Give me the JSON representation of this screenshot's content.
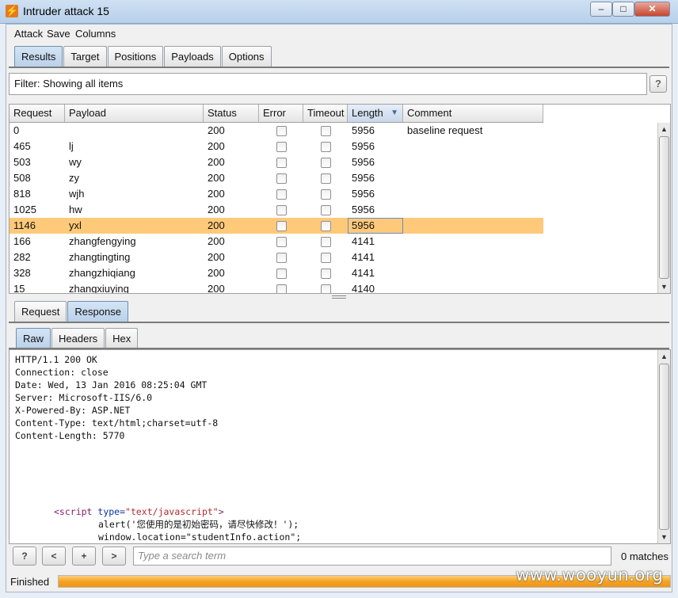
{
  "window": {
    "title": "Intruder attack 15",
    "minimize": "–",
    "maximize": "□",
    "close": "✕",
    "app_icon": "⚡"
  },
  "menu": [
    "Attack",
    "Save",
    "Columns"
  ],
  "main_tabs": [
    "Results",
    "Target",
    "Positions",
    "Payloads",
    "Options"
  ],
  "active_main_tab": "Results",
  "filter": {
    "text": "Filter: Showing all items",
    "help": "?"
  },
  "table": {
    "columns": [
      "Request",
      "Payload",
      "Status",
      "Error",
      "Timeout",
      "Length",
      "Comment"
    ],
    "sorted_column": "Length",
    "sort_icon": "▼",
    "rows": [
      {
        "request": "0",
        "payload": "",
        "status": "200",
        "error": false,
        "timeout": false,
        "length": "5956",
        "comment": "baseline request"
      },
      {
        "request": "465",
        "payload": "lj",
        "status": "200",
        "error": false,
        "timeout": false,
        "length": "5956",
        "comment": ""
      },
      {
        "request": "503",
        "payload": "wy",
        "status": "200",
        "error": false,
        "timeout": false,
        "length": "5956",
        "comment": ""
      },
      {
        "request": "508",
        "payload": "zy",
        "status": "200",
        "error": false,
        "timeout": false,
        "length": "5956",
        "comment": ""
      },
      {
        "request": "818",
        "payload": "wjh",
        "status": "200",
        "error": false,
        "timeout": false,
        "length": "5956",
        "comment": ""
      },
      {
        "request": "1025",
        "payload": "hw",
        "status": "200",
        "error": false,
        "timeout": false,
        "length": "5956",
        "comment": ""
      },
      {
        "request": "1146",
        "payload": "yxl",
        "status": "200",
        "error": false,
        "timeout": false,
        "length": "5956",
        "comment": "",
        "selected": true
      },
      {
        "request": "166",
        "payload": "zhangfengying",
        "status": "200",
        "error": false,
        "timeout": false,
        "length": "4141",
        "comment": ""
      },
      {
        "request": "282",
        "payload": "zhangtingting",
        "status": "200",
        "error": false,
        "timeout": false,
        "length": "4141",
        "comment": ""
      },
      {
        "request": "328",
        "payload": "zhangzhiqiang",
        "status": "200",
        "error": false,
        "timeout": false,
        "length": "4141",
        "comment": ""
      },
      {
        "request": "15",
        "payload": "zhangxiuying",
        "status": "200",
        "error": false,
        "timeout": false,
        "length": "4140",
        "comment": ""
      }
    ]
  },
  "detail_tabs": [
    "Request",
    "Response"
  ],
  "active_detail_tab": "Response",
  "view_tabs": [
    "Raw",
    "Headers",
    "Hex"
  ],
  "active_view_tab": "Raw",
  "response": {
    "headers": [
      "HTTP/1.1 200 OK",
      "Connection: close",
      "Date: Wed, 13 Jan 2016 08:25:04 GMT",
      "Server: Microsoft-IIS/6.0",
      "X-Powered-By: ASP.NET",
      "Content-Type: text/html;charset=utf-8",
      "Content-Length: 5770"
    ],
    "script_open_tag": "<script",
    "script_attr": "type=",
    "script_attr_value": "\"text/javascript\"",
    "script_close_bracket": ">",
    "script_line1": "alert('您使用的是初始密码，请尽快修改！');",
    "script_line2": "window.location=\"studentInfo.action\";"
  },
  "search": {
    "help": "?",
    "prev": "<",
    "add": "+",
    "next": ">",
    "placeholder": "Type a search term",
    "matches": "0 matches"
  },
  "status": {
    "text": "Finished",
    "progress": 1.0
  },
  "watermark": "www.wooyun.org"
}
